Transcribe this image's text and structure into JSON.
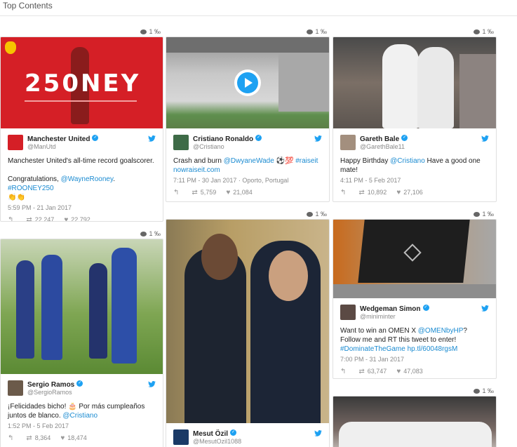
{
  "page": {
    "title": "Top Contents"
  },
  "cards": {
    "manutd": {
      "meta": "1 ‰",
      "media": "250NEY",
      "name": "Manchester United",
      "handle": "@ManUtd",
      "text1": "Manchester United's all-time record goalscorer.",
      "text2a": "Congratulations, ",
      "mention": "@WayneRooney",
      "text2b": ". ",
      "hashtag": "#ROONEY250",
      "emoji": "👏👏",
      "time": "5:59 PM - 21 Jan 2017",
      "retweets": "22,247",
      "likes": "22,792"
    },
    "ronaldo": {
      "meta": "1 ‰",
      "name": "Cristiano Ronaldo",
      "handle": "@Cristiano",
      "text_a": "Crash and burn ",
      "mention": "@DwyaneWade",
      "emoji": " ⚽💯 ",
      "hashtag": "#raiseit",
      "link": "nowraiseit.com",
      "time": "7:11 PM - 30 Jan 2017 · Oporto, Portugal",
      "retweets": "5,759",
      "likes": "21,084"
    },
    "bale": {
      "meta": "1 ‰",
      "name": "Gareth Bale",
      "handle": "@GarethBale11",
      "text_a": "Happy Birthday ",
      "mention": "@Cristiano",
      "text_b": " Have a good one mate!",
      "time": "4:11 PM - 5 Feb 2017",
      "retweets": "10,892",
      "likes": "27,106"
    },
    "ramos": {
      "meta": "1 ‰",
      "name": "Sergio Ramos",
      "handle": "@SergioRamos",
      "text_a": "¡Felicidades bicho! 🎂 Por más cumpleaños juntos de blanco. ",
      "mention": "@Cristiano",
      "time": "1:52 PM - 5 Feb 2017",
      "retweets": "8,364",
      "likes": "18,474"
    },
    "ozil": {
      "meta": "1 ‰",
      "name": "Mesut Özil",
      "handle": "@MesutOzil1088"
    },
    "simon": {
      "meta": "1 ‰",
      "name": "Wedgeman Simon",
      "handle": "@miniminter",
      "text_a": "Want to win an OMEN X ",
      "mention": "@OMENbyHP",
      "text_b": "? Follow me and RT this tweet to enter!",
      "hashtag": "#DominateTheGame",
      "link": " hp.tl/60048rgsM",
      "time": "7:00 PM - 31 Jan 2017",
      "retweets": "63,747",
      "likes": "47,083"
    },
    "team": {
      "meta": "1 ‰"
    }
  }
}
